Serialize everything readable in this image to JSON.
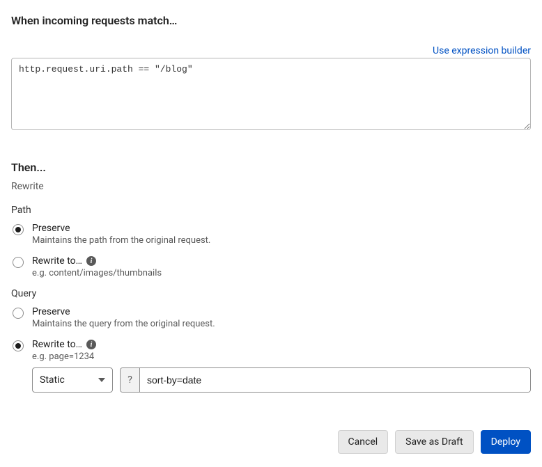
{
  "header": {
    "when_title": "When incoming requests match…",
    "expression_builder_link": "Use expression builder",
    "expression_value": "http.request.uri.path == \"/blog\""
  },
  "then": {
    "title": "Then...",
    "action_label": "Rewrite"
  },
  "path": {
    "group_label": "Path",
    "preserve": {
      "label": "Preserve",
      "help": "Maintains the path from the original request.",
      "selected": true
    },
    "rewrite": {
      "label": "Rewrite to…",
      "help": "e.g. content/images/thumbnails",
      "selected": false
    }
  },
  "query": {
    "group_label": "Query",
    "preserve": {
      "label": "Preserve",
      "help": "Maintains the query from the original request.",
      "selected": false
    },
    "rewrite": {
      "label": "Rewrite to…",
      "help": "e.g. page=1234",
      "selected": true,
      "mode_select": "Static",
      "prefix": "?",
      "value": "sort-by=date"
    }
  },
  "footer": {
    "cancel": "Cancel",
    "save_draft": "Save as Draft",
    "deploy": "Deploy"
  },
  "icons": {
    "info": "i"
  }
}
